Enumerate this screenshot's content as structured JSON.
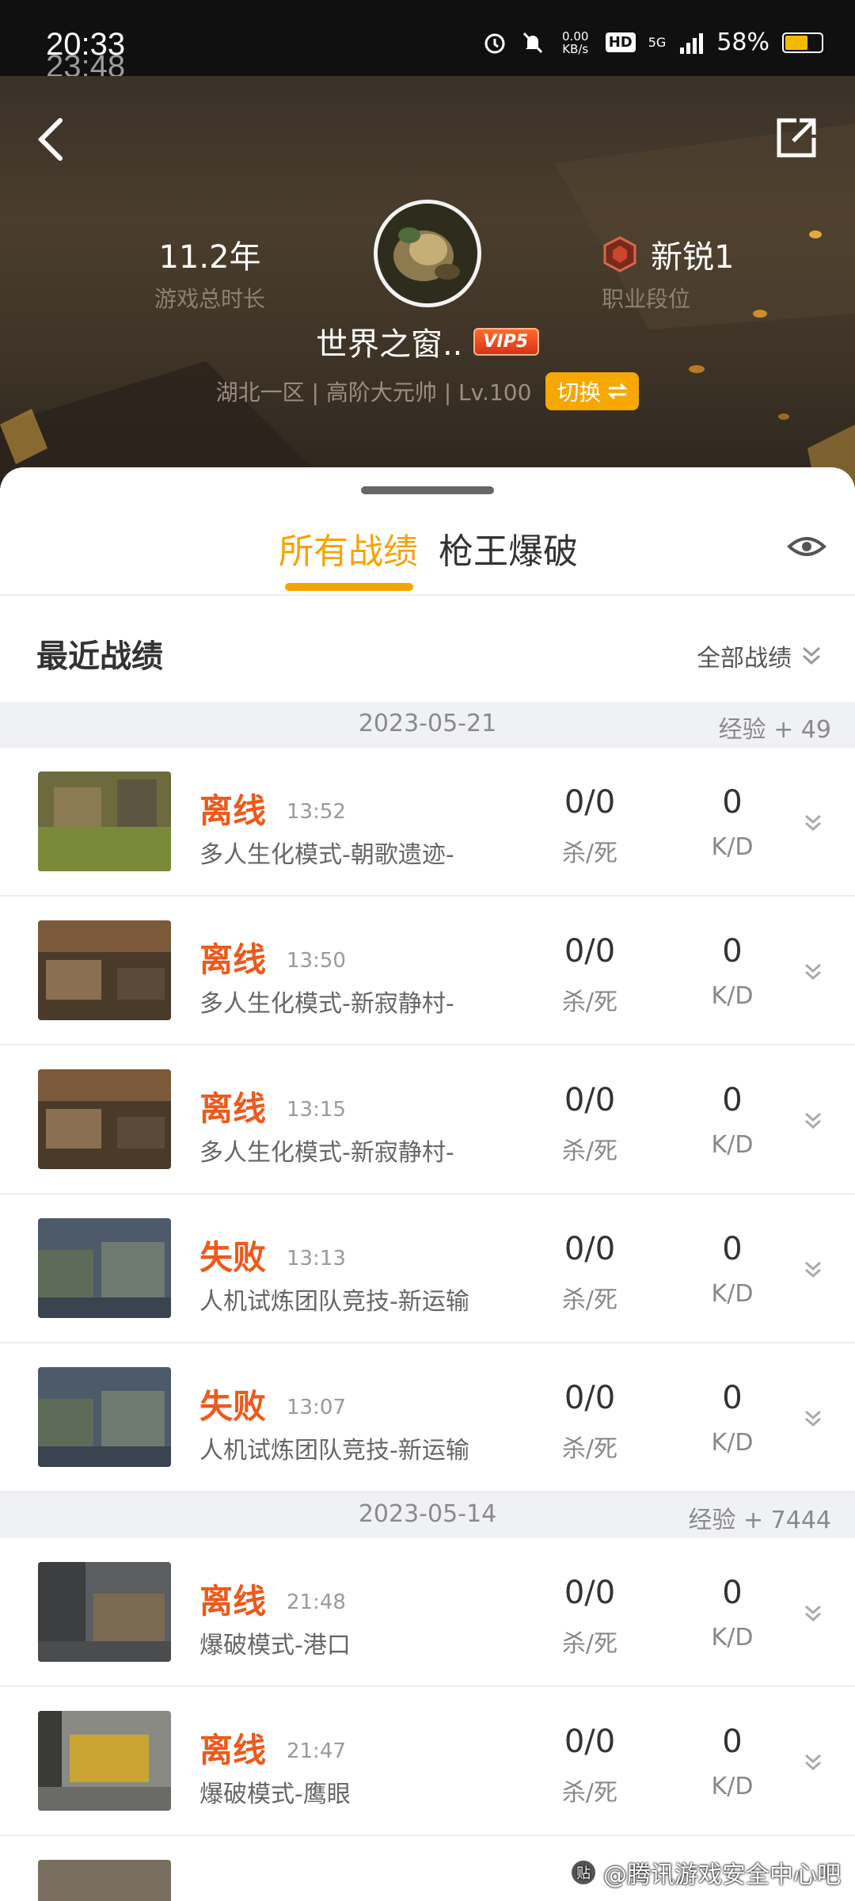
{
  "status_bar": {
    "time": "20:33",
    "ghost_time": "23:48",
    "speed": "0.00\nKB/s",
    "hd": "HD",
    "network": "5G",
    "battery": "58%"
  },
  "header": {
    "play_time": {
      "value": "11.2年",
      "label": "游戏总时长"
    },
    "rank": {
      "value": "新锐1",
      "label": "职业段位"
    },
    "nickname": "世界之窗..",
    "vip": "VIP5",
    "server": "湖北一区 | 高阶大元帅 | Lv.100",
    "switch_label": "切换"
  },
  "tabs": [
    {
      "label": "所有战绩",
      "active": true
    },
    {
      "label": "枪王爆破",
      "active": false
    }
  ],
  "section": {
    "title": "最近战绩",
    "filter_label": "全部战绩"
  },
  "groups": [
    {
      "date": "2023-05-21",
      "exp": "经验 + 49",
      "matches": [
        {
          "result": "离线",
          "time": "13:52",
          "mode": "多人生化模式-朝歌遗迹-",
          "kd": "0/0",
          "kd_label": "杀/死",
          "ratio": "0",
          "ratio_label": "K/D",
          "thumb": "ruins"
        },
        {
          "result": "离线",
          "time": "13:50",
          "mode": "多人生化模式-新寂静村-",
          "kd": "0/0",
          "kd_label": "杀/死",
          "ratio": "0",
          "ratio_label": "K/D",
          "thumb": "village"
        },
        {
          "result": "离线",
          "time": "13:15",
          "mode": "多人生化模式-新寂静村-",
          "kd": "0/0",
          "kd_label": "杀/死",
          "ratio": "0",
          "ratio_label": "K/D",
          "thumb": "village"
        },
        {
          "result": "失败",
          "time": "13:13",
          "mode": "人机试炼团队竞技-新运输",
          "kd": "0/0",
          "kd_label": "杀/死",
          "ratio": "0",
          "ratio_label": "K/D",
          "thumb": "cargo"
        },
        {
          "result": "失败",
          "time": "13:07",
          "mode": "人机试炼团队竞技-新运输",
          "kd": "0/0",
          "kd_label": "杀/死",
          "ratio": "0",
          "ratio_label": "K/D",
          "thumb": "cargo"
        }
      ]
    },
    {
      "date": "2023-05-14",
      "exp": "经验 + 7444",
      "matches": [
        {
          "result": "离线",
          "time": "21:48",
          "mode": "爆破模式-港口",
          "kd": "0/0",
          "kd_label": "杀/死",
          "ratio": "0",
          "ratio_label": "K/D",
          "thumb": "port"
        },
        {
          "result": "离线",
          "time": "21:47",
          "mode": "爆破模式-鹰眼",
          "kd": "0/0",
          "kd_label": "杀/死",
          "ratio": "0",
          "ratio_label": "K/D",
          "thumb": "eagle"
        }
      ]
    }
  ],
  "watermark": "@腾讯游戏安全中心吧",
  "watermark_icon_text": "贴",
  "colors": {
    "accent": "#f5a300",
    "result": "#ec5a1c",
    "header_bg": "#3a3128"
  }
}
